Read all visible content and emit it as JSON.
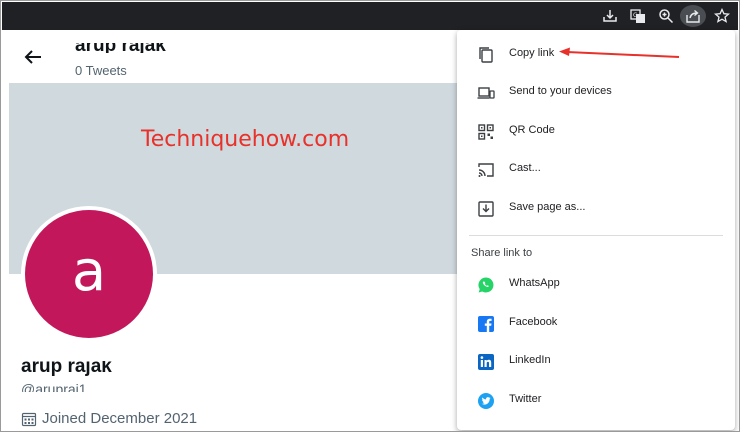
{
  "profile": {
    "name": "arup rajak",
    "tweet_count": "0 Tweets",
    "handle": "@arupraj1",
    "joined": "Joined December 2021",
    "avatar_letter": "a",
    "avatar_color": "#c2185b",
    "banner_color": "#cfd9de"
  },
  "watermark": "Techniquehow.com",
  "browser_toolbar": {
    "icons": [
      "install-icon",
      "translate-icon",
      "zoom-icon",
      "share-icon",
      "bookmark-star-icon"
    ]
  },
  "share_menu": {
    "items": [
      {
        "label": "Copy link",
        "icon": "copy-icon"
      },
      {
        "label": "Send to your devices",
        "icon": "devices-icon"
      },
      {
        "label": "QR Code",
        "icon": "qr-code-icon"
      },
      {
        "label": "Cast...",
        "icon": "cast-icon"
      },
      {
        "label": "Save page as...",
        "icon": "save-page-icon"
      }
    ],
    "share_section_label": "Share link to",
    "share_targets": [
      {
        "label": "WhatsApp",
        "icon": "whatsapp-icon",
        "color": "#25d366"
      },
      {
        "label": "Facebook",
        "icon": "facebook-icon",
        "color": "#1877f2"
      },
      {
        "label": "LinkedIn",
        "icon": "linkedin-icon",
        "color": "#0a66c2"
      },
      {
        "label": "Twitter",
        "icon": "twitter-icon",
        "color": "#1da1f2"
      }
    ]
  },
  "annotation_color": "#e8312a"
}
